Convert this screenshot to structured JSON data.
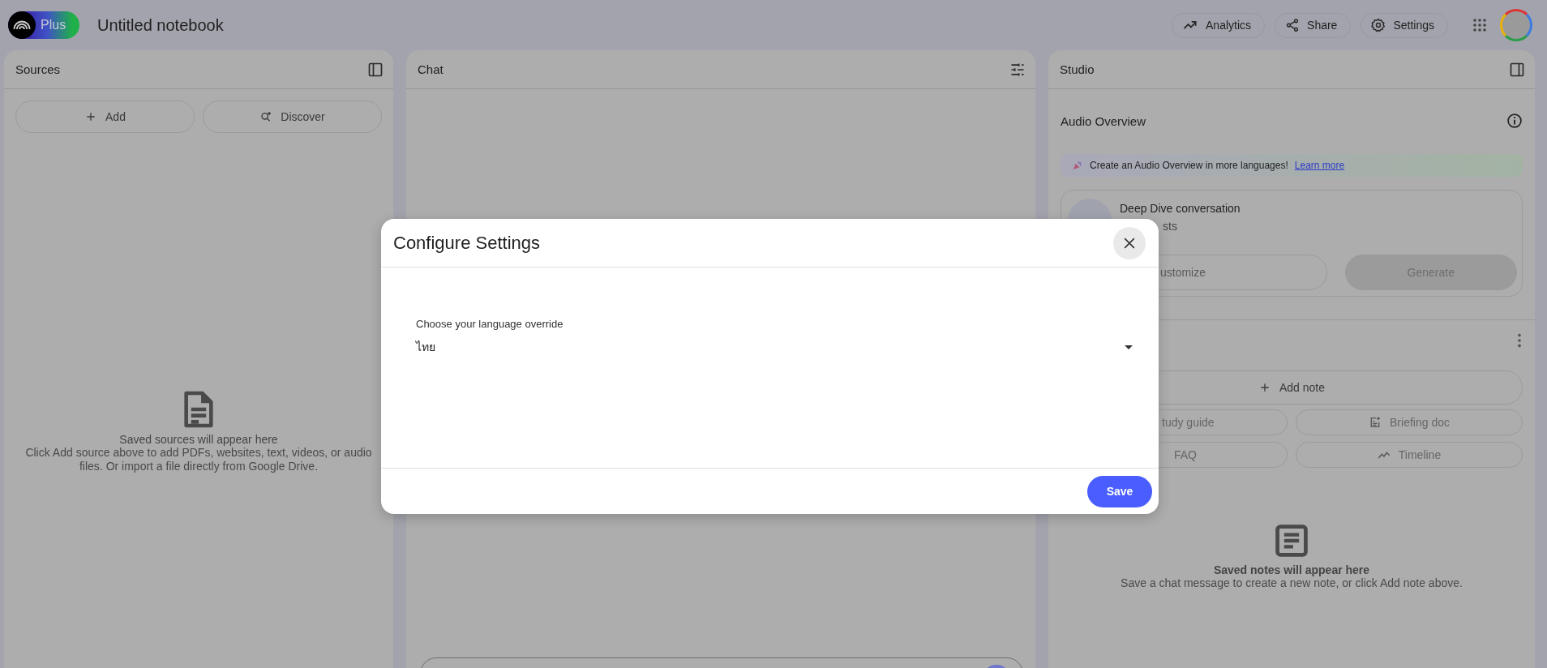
{
  "app": {
    "badge": "Plus",
    "title": "Untitled notebook"
  },
  "top_actions": [
    {
      "label": "Analytics",
      "kind": "analytics"
    },
    {
      "label": "Share",
      "kind": "share"
    },
    {
      "label": "Settings",
      "kind": "settings"
    }
  ],
  "sources": {
    "title": "Sources",
    "buttons": [
      {
        "label": "Add",
        "kind": "add"
      },
      {
        "label": "Discover",
        "kind": "discover"
      }
    ],
    "empty_title": "Saved sources will appear here",
    "empty_text": "Click Add source above to add PDFs, websites, text, videos, or audio files. Or import a file directly from Google Drive."
  },
  "chat": {
    "title": "Chat"
  },
  "studio": {
    "title": "Studio",
    "audio_title": "Audio Overview",
    "banner_text": "Create an Audio Overview in more languages!",
    "banner_link": "Learn more",
    "card_title": "Deep Dive conversation",
    "card_subtitle": "sts",
    "card_buttons": [
      {
        "label": "ustomize",
        "kind": "outlined"
      },
      {
        "label": "Generate",
        "kind": "filled"
      }
    ],
    "add_note": "Add note",
    "note_buttons": [
      {
        "label": "tudy guide",
        "kind": "study"
      },
      {
        "label": "Briefing doc",
        "kind": "briefing"
      },
      {
        "label": "FAQ",
        "kind": "faq"
      },
      {
        "label": "Timeline",
        "kind": "timeline"
      }
    ],
    "empty_title": "Saved notes will appear here",
    "empty_text": "Save a chat message to create a new note, or click Add note above."
  },
  "dialog": {
    "title": "Configure Settings",
    "field_label": "Choose your language override",
    "value": "ไทย",
    "save": "Save"
  }
}
